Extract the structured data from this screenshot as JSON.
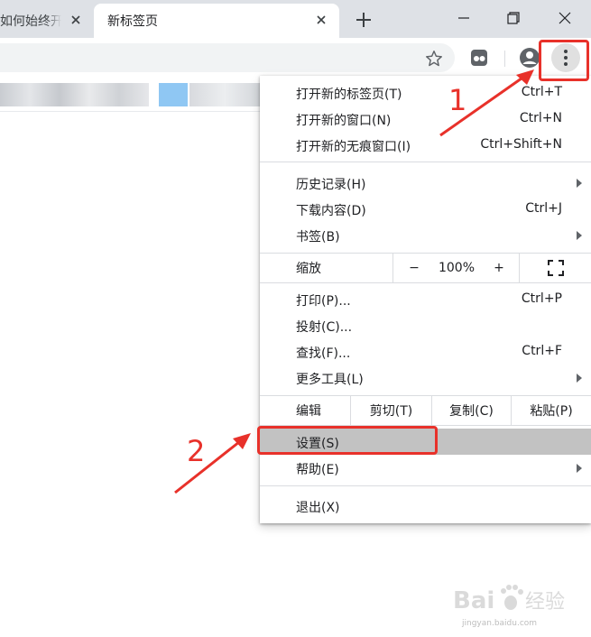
{
  "tabs": [
    {
      "title": "如何始终开",
      "active": false
    },
    {
      "title": "新标签页",
      "active": true
    }
  ],
  "colors": {
    "accent_annotation": "#e8312a",
    "tabstrip": "#dee1e6",
    "highlight": "#c2c2c2"
  },
  "menu": {
    "group1": [
      {
        "label": "打开新的标签页(T)",
        "shortcut": "Ctrl+T"
      },
      {
        "label": "打开新的窗口(N)",
        "shortcut": "Ctrl+N"
      },
      {
        "label": "打开新的无痕窗口(I)",
        "shortcut": "Ctrl+Shift+N"
      }
    ],
    "group2": [
      {
        "label": "历史记录(H)",
        "submenu": true
      },
      {
        "label": "下载内容(D)",
        "shortcut": "Ctrl+J"
      },
      {
        "label": "书签(B)",
        "submenu": true
      }
    ],
    "zoom": {
      "label": "缩放",
      "minus": "−",
      "value": "100%",
      "plus": "+",
      "fullscreen_icon": "fullscreen-icon"
    },
    "group3": [
      {
        "label": "打印(P)...",
        "shortcut": "Ctrl+P"
      },
      {
        "label": "投射(C)..."
      },
      {
        "label": "查找(F)...",
        "shortcut": "Ctrl+F"
      },
      {
        "label": "更多工具(L)",
        "submenu": true
      }
    ],
    "edit": {
      "label": "编辑",
      "cut": "剪切(T)",
      "copy": "复制(C)",
      "paste": "粘贴(P)"
    },
    "group4": [
      {
        "label": "设置(S)",
        "highlighted": true
      },
      {
        "label": "帮助(E)",
        "submenu": true
      }
    ],
    "exit": {
      "label": "退出(X)"
    }
  },
  "annotations": {
    "step1": "1",
    "step2": "2"
  },
  "watermark": {
    "brand": "Bai经验",
    "site": "jingyan.baidu.com"
  }
}
